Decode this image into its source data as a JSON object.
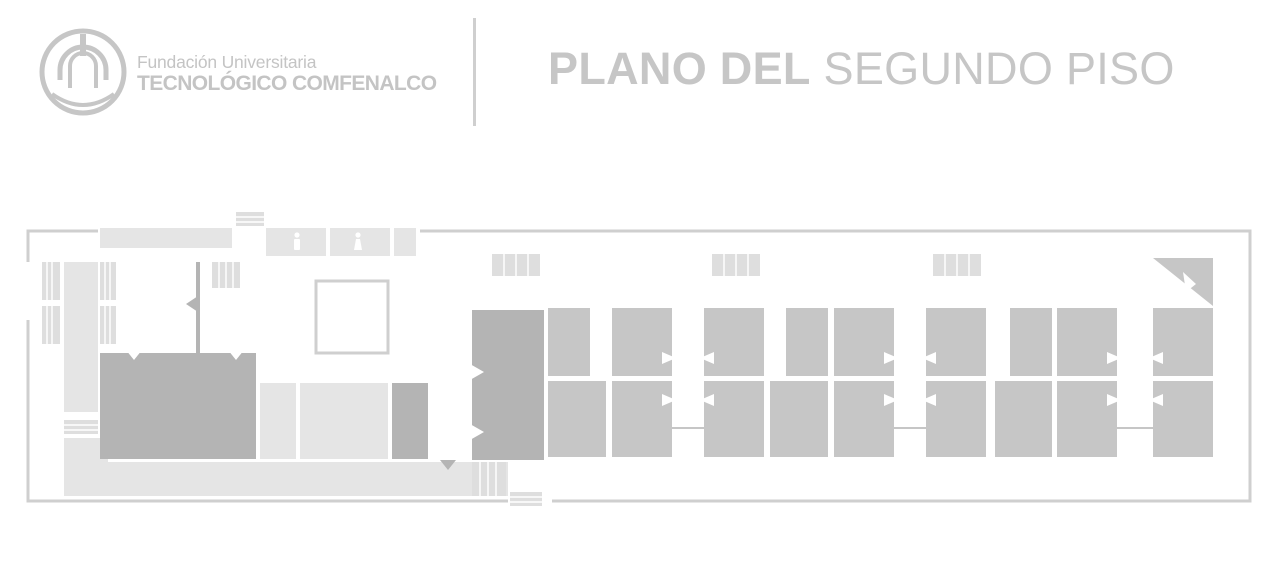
{
  "header": {
    "logo": {
      "line1": "Fundación Universitaria",
      "line2": "TECNOLÓGICO COMFENALCO"
    },
    "title_bold": "PLANO DEL",
    "title_rest": "SEGUNDO PISO"
  },
  "colors": {
    "wall": "#cfcfcf",
    "room_dark": "#b4b4b4",
    "room_medium": "#c6c6c6",
    "room_light": "#e5e5e5",
    "text": "#c4c4c4"
  },
  "icons": {
    "restroom_men": "man-icon",
    "restroom_women": "woman-icon",
    "stairs": "stairs-icon",
    "logo": "seal-icon"
  }
}
